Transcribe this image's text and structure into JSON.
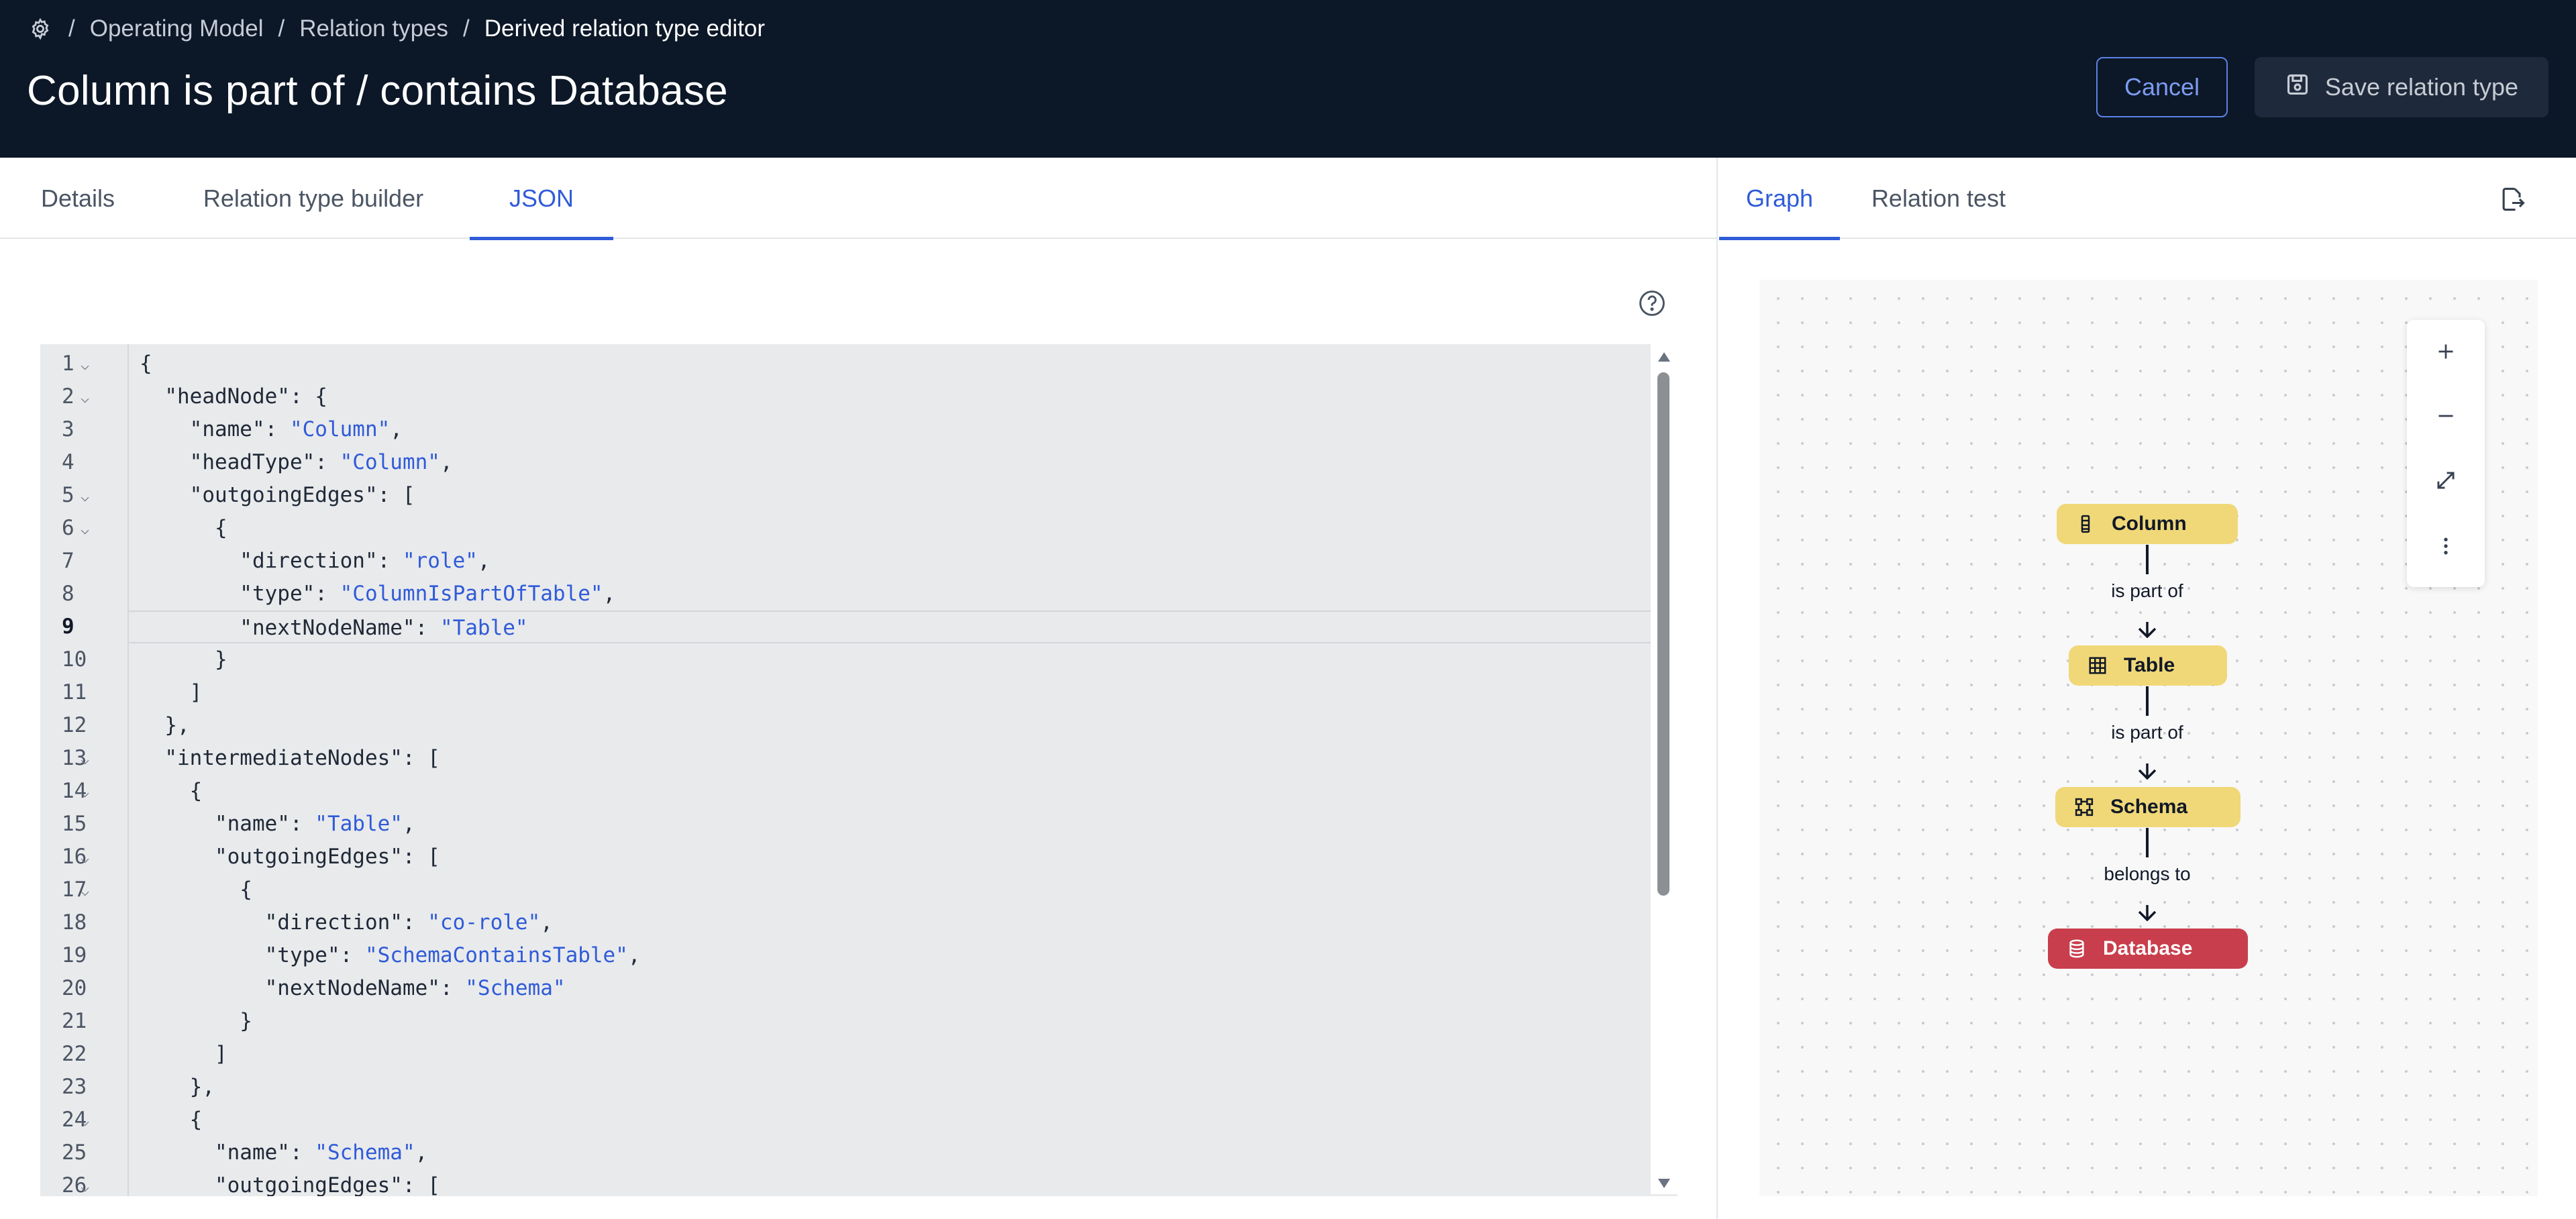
{
  "breadcrumb": {
    "items": [
      "Operating Model",
      "Relation types",
      "Derived relation type editor"
    ],
    "separator": "/"
  },
  "page_title": "Column is part of / contains Database",
  "actions": {
    "cancel_label": "Cancel",
    "save_label": "Save relation type"
  },
  "left_tabs": [
    {
      "label": "Details",
      "active": false
    },
    {
      "label": "Relation type builder",
      "active": false
    },
    {
      "label": "JSON",
      "active": true
    }
  ],
  "right_tabs": [
    {
      "label": "Graph",
      "active": true
    },
    {
      "label": "Relation test",
      "active": false
    }
  ],
  "editor": {
    "current_line": 9,
    "lines": [
      {
        "n": "1",
        "fold": true,
        "segs": [
          [
            "p",
            "{"
          ]
        ]
      },
      {
        "n": "2",
        "fold": true,
        "segs": [
          [
            "p",
            "  \"headNode\": {"
          ]
        ]
      },
      {
        "n": "3",
        "fold": false,
        "segs": [
          [
            "p",
            "    \"name\": "
          ],
          [
            "s",
            "\"Column\""
          ],
          [
            "p",
            ","
          ]
        ]
      },
      {
        "n": "4",
        "fold": false,
        "segs": [
          [
            "p",
            "    \"headType\": "
          ],
          [
            "s",
            "\"Column\""
          ],
          [
            "p",
            ","
          ]
        ]
      },
      {
        "n": "5",
        "fold": true,
        "segs": [
          [
            "p",
            "    \"outgoingEdges\": ["
          ]
        ]
      },
      {
        "n": "6",
        "fold": true,
        "segs": [
          [
            "p",
            "      {"
          ]
        ]
      },
      {
        "n": "7",
        "fold": false,
        "segs": [
          [
            "p",
            "        \"direction\": "
          ],
          [
            "s",
            "\"role\""
          ],
          [
            "p",
            ","
          ]
        ]
      },
      {
        "n": "8",
        "fold": false,
        "segs": [
          [
            "p",
            "        \"type\": "
          ],
          [
            "s",
            "\"ColumnIsPartOfTable\""
          ],
          [
            "p",
            ","
          ]
        ]
      },
      {
        "n": "9",
        "fold": false,
        "segs": [
          [
            "p",
            "        \"nextNodeName\": "
          ],
          [
            "s",
            "\"Table\""
          ]
        ]
      },
      {
        "n": "10",
        "fold": false,
        "segs": [
          [
            "p",
            "      }"
          ]
        ]
      },
      {
        "n": "11",
        "fold": false,
        "segs": [
          [
            "p",
            "    ]"
          ]
        ]
      },
      {
        "n": "12",
        "fold": false,
        "segs": [
          [
            "p",
            "  },"
          ]
        ]
      },
      {
        "n": "13",
        "fold": true,
        "segs": [
          [
            "p",
            "  \"intermediateNodes\": ["
          ]
        ]
      },
      {
        "n": "14",
        "fold": true,
        "segs": [
          [
            "p",
            "    {"
          ]
        ]
      },
      {
        "n": "15",
        "fold": false,
        "segs": [
          [
            "p",
            "      \"name\": "
          ],
          [
            "s",
            "\"Table\""
          ],
          [
            "p",
            ","
          ]
        ]
      },
      {
        "n": "16",
        "fold": true,
        "segs": [
          [
            "p",
            "      \"outgoingEdges\": ["
          ]
        ]
      },
      {
        "n": "17",
        "fold": true,
        "segs": [
          [
            "p",
            "        {"
          ]
        ]
      },
      {
        "n": "18",
        "fold": false,
        "segs": [
          [
            "p",
            "          \"direction\": "
          ],
          [
            "s",
            "\"co-role\""
          ],
          [
            "p",
            ","
          ]
        ]
      },
      {
        "n": "19",
        "fold": false,
        "segs": [
          [
            "p",
            "          \"type\": "
          ],
          [
            "s",
            "\"SchemaContainsTable\""
          ],
          [
            "p",
            ","
          ]
        ]
      },
      {
        "n": "20",
        "fold": false,
        "segs": [
          [
            "p",
            "          \"nextNodeName\": "
          ],
          [
            "s",
            "\"Schema\""
          ]
        ]
      },
      {
        "n": "21",
        "fold": false,
        "segs": [
          [
            "p",
            "        }"
          ]
        ]
      },
      {
        "n": "22",
        "fold": false,
        "segs": [
          [
            "p",
            "      ]"
          ]
        ]
      },
      {
        "n": "23",
        "fold": false,
        "segs": [
          [
            "p",
            "    },"
          ]
        ]
      },
      {
        "n": "24",
        "fold": true,
        "segs": [
          [
            "p",
            "    {"
          ]
        ]
      },
      {
        "n": "25",
        "fold": false,
        "segs": [
          [
            "p",
            "      \"name\": "
          ],
          [
            "s",
            "\"Schema\""
          ],
          [
            "p",
            ","
          ]
        ]
      },
      {
        "n": "26",
        "fold": true,
        "segs": [
          [
            "p",
            "      \"outgoingEdges\": ["
          ]
        ]
      }
    ]
  },
  "graph": {
    "nodes": [
      {
        "label": "Column",
        "icon": "column-icon",
        "color": "#f0d878"
      },
      {
        "label": "Table",
        "icon": "table-icon",
        "color": "#f0d878"
      },
      {
        "label": "Schema",
        "icon": "schema-icon",
        "color": "#f0d878"
      },
      {
        "label": "Database",
        "icon": "database-icon",
        "color": "#c93e4c"
      }
    ],
    "edges": [
      {
        "label": "is part of"
      },
      {
        "label": "is part of"
      },
      {
        "label": "belongs to"
      }
    ]
  },
  "colors": {
    "header_bg": "#0c1727",
    "accent": "#2f5bd8",
    "string_literal": "#2f5bd8",
    "node_yellow": "#f0d878",
    "node_red": "#c93e4c"
  }
}
